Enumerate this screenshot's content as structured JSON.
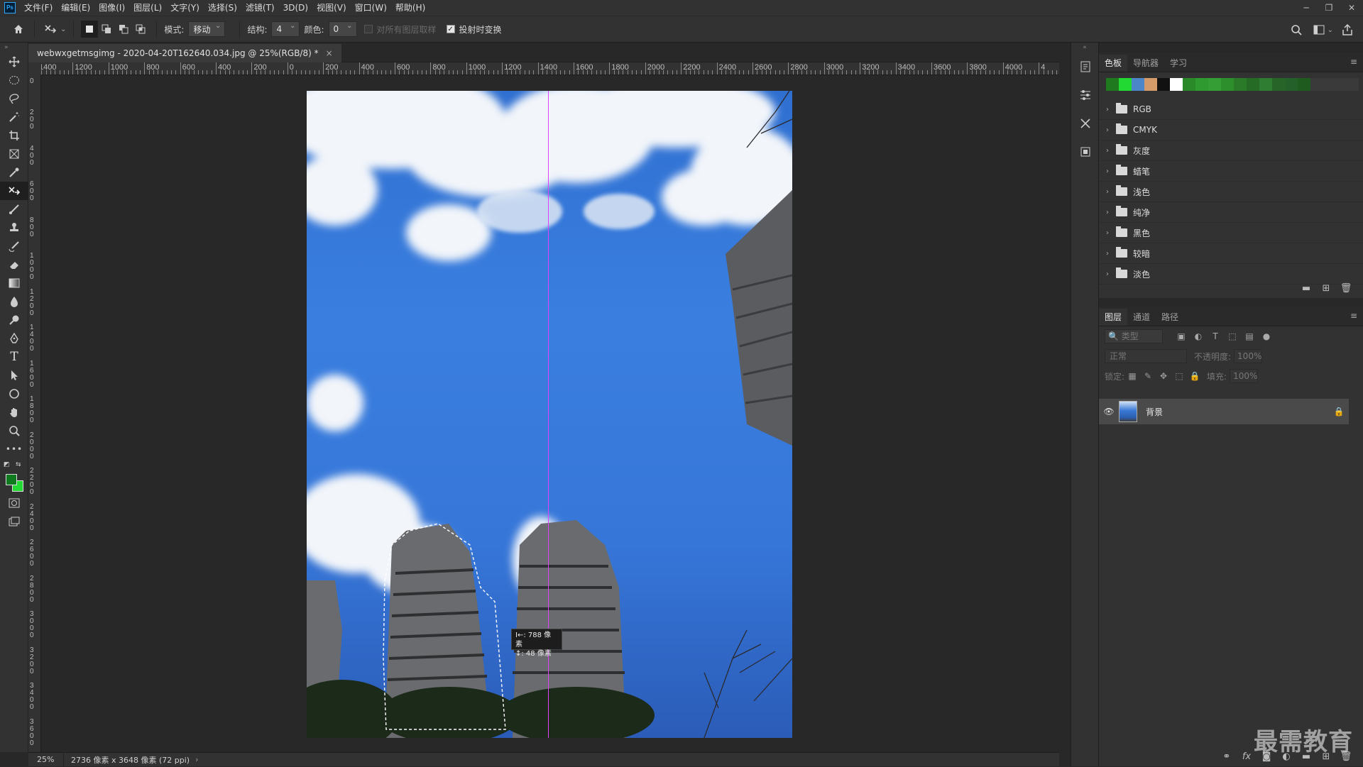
{
  "app": {
    "logo": "Ps"
  },
  "menu": [
    "文件(F)",
    "编辑(E)",
    "图像(I)",
    "图层(L)",
    "文字(Y)",
    "选择(S)",
    "滤镜(T)",
    "3D(D)",
    "视图(V)",
    "窗口(W)",
    "帮助(H)"
  ],
  "options_bar": {
    "mode_label": "模式:",
    "mode_value": "移动",
    "structure_label": "结构:",
    "structure_value": "4",
    "color_label": "颜色:",
    "color_value": "0",
    "sample_all_layers": "对所有图层取样",
    "transform_on_drop": "投射时变换"
  },
  "document": {
    "tab_title": "webwxgetmsgimg - 2020-04-20T162640.034.jpg @ 25%(RGB/8) *",
    "tooltip_line1": "I←: 788 像素",
    "tooltip_line2": "↕: 48 像素"
  },
  "ruler": {
    "h_labels": [
      "1400",
      "1200",
      "1000",
      "800",
      "600",
      "400",
      "200",
      "0",
      "200",
      "400",
      "600",
      "800",
      "1000",
      "1200",
      "1400",
      "1600",
      "1800",
      "2000",
      "2200",
      "2400",
      "2600",
      "2800",
      "3000",
      "3200",
      "3400",
      "3600",
      "3800",
      "4000",
      "4"
    ],
    "v_labels": [
      "0",
      "0",
      "2\n0\n0",
      "4\n0\n0",
      "6\n0\n0",
      "8\n0\n0",
      "1\n0\n0\n0",
      "1\n2\n0\n0",
      "1\n4\n0\n0",
      "1\n6\n0\n0",
      "1\n8\n0\n0",
      "2\n0\n0\n0",
      "2\n2\n0\n0",
      "2\n4\n0\n0",
      "2\n6\n0\n0",
      "2\n8\n0\n0",
      "3\n0\n0\n0",
      "3\n2\n0\n0",
      "3\n4\n0\n0",
      "3\n6\n0\n0"
    ]
  },
  "status": {
    "zoom": "25%",
    "info": "2736 像素 x 3648 像素 (72 ppi)"
  },
  "swatches_panel": {
    "tabs": [
      "色板",
      "导航器",
      "学习"
    ],
    "recent_colors": [
      "#1f7a1f",
      "#22d832",
      "#4a86c8",
      "#d49a6a",
      "#111111",
      "#ffffff",
      "#2a8a2a",
      "#2f9a2f",
      "#359f35",
      "#2c8f2c",
      "#2a7a2a",
      "#256a25",
      "#2e7d32",
      "#276427",
      "#23602a",
      "#1f5a1f"
    ],
    "groups": [
      "RGB",
      "CMYK",
      "灰度",
      "蜡笔",
      "浅色",
      "纯净",
      "黑色",
      "较暗",
      "淡色"
    ]
  },
  "layers_panel": {
    "tabs": [
      "图层",
      "通道",
      "路径"
    ],
    "filter_placeholder": "类型",
    "blend_mode": "正常",
    "opacity_label": "不透明度:",
    "opacity_value": "100%",
    "lock_label": "锁定:",
    "fill_label": "填充:",
    "fill_value": "100%",
    "layer_name": "背景"
  },
  "watermark": "最需教育"
}
